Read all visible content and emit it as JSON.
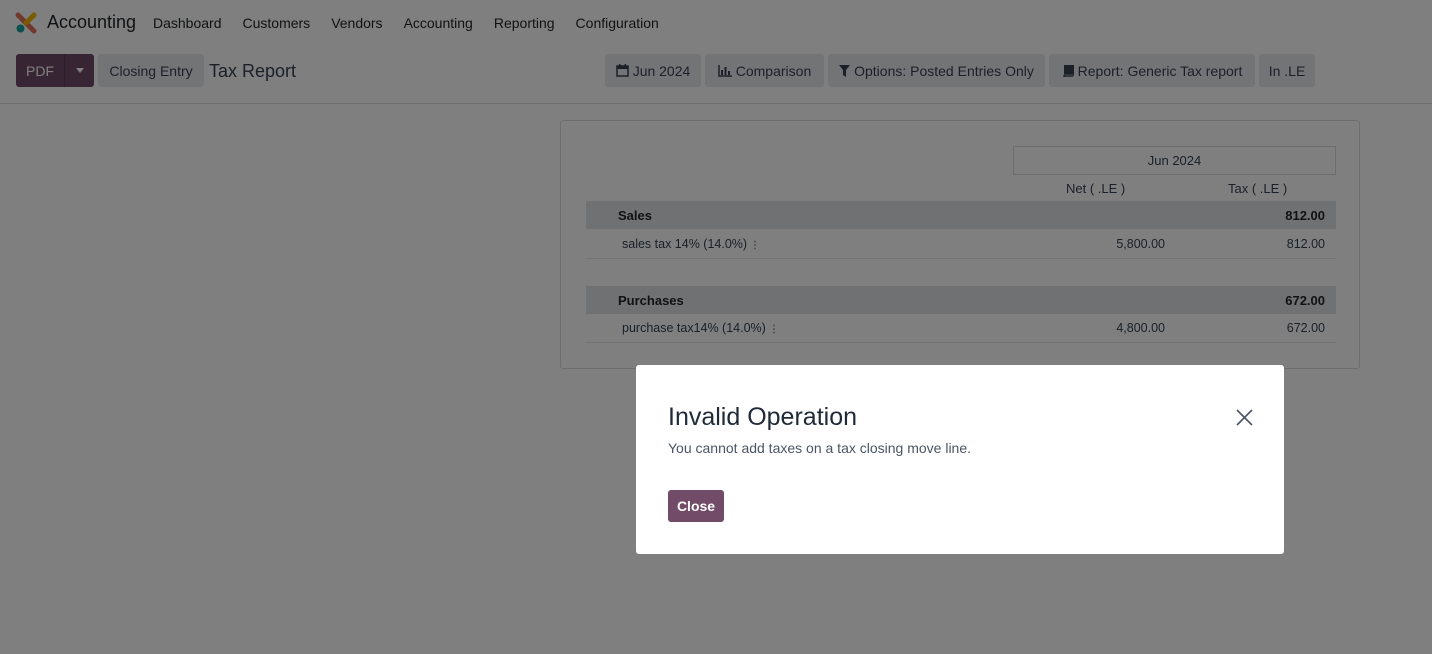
{
  "app": {
    "title": "Accounting"
  },
  "menu": [
    "Dashboard",
    "Customers",
    "Vendors",
    "Accounting",
    "Reporting",
    "Configuration"
  ],
  "control": {
    "pdf_label": "PDF",
    "closing_label": "Closing Entry",
    "page_title": "Tax Report",
    "filters": {
      "period": "Jun 2024",
      "comparison": "Comparison",
      "options": "Options: Posted Entries Only",
      "report": "Report: Generic Tax report",
      "currency": "In .LE"
    }
  },
  "report": {
    "period_header": "Jun 2024",
    "col_net": "Net ( .LE )",
    "col_tax": "Tax ( .LE )",
    "sections": [
      {
        "name": "Sales",
        "total": "812.00",
        "lines": [
          {
            "label": "sales tax 14% (14.0%)",
            "net": "5,800.00",
            "tax": "812.00"
          }
        ]
      },
      {
        "name": "Purchases",
        "total": "672.00",
        "lines": [
          {
            "label": "purchase tax14% (14.0%)",
            "net": "4,800.00",
            "tax": "672.00"
          }
        ]
      }
    ]
  },
  "dialog": {
    "title": "Invalid Operation",
    "message": "You cannot add taxes on a tax closing move line.",
    "close_label": "Close"
  },
  "colors": {
    "brand": "#714b67",
    "overlay": "rgba(0,0,0,0.5)"
  }
}
